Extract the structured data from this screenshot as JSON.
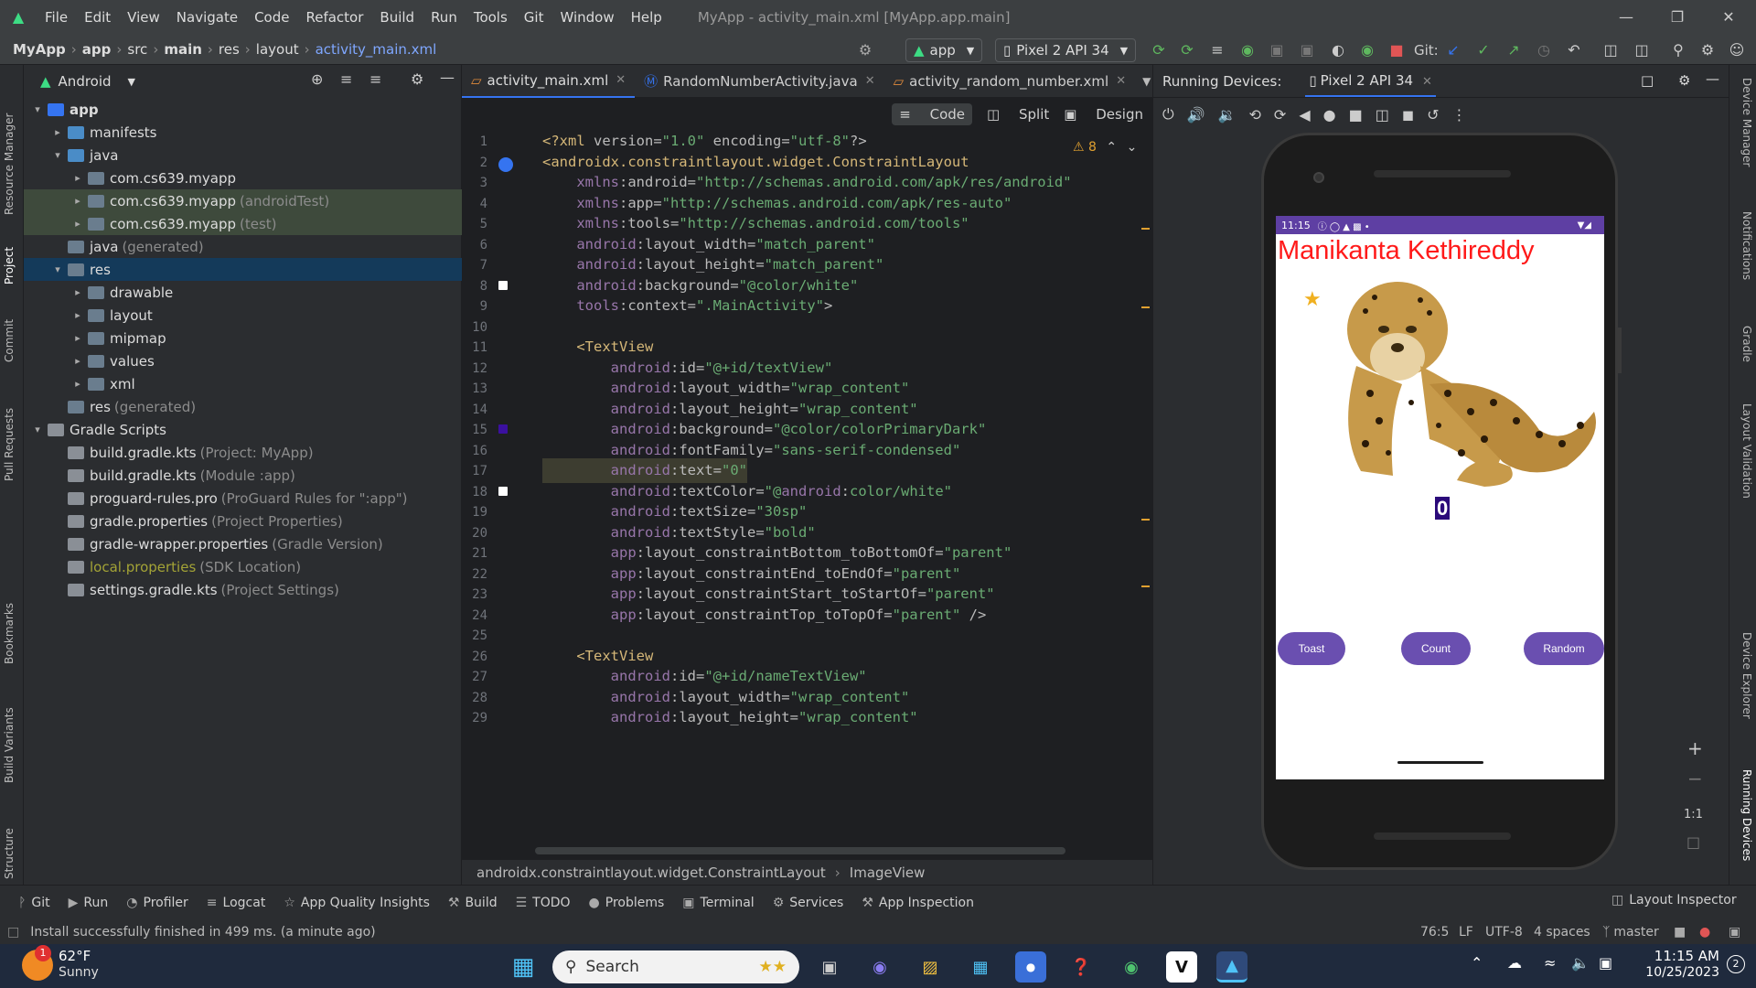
{
  "menu": {
    "items": [
      "File",
      "Edit",
      "View",
      "Navigate",
      "Code",
      "Refactor",
      "Build",
      "Run",
      "Tools",
      "Git",
      "Window",
      "Help"
    ],
    "title": "MyApp - activity_main.xml [MyApp.app.main]"
  },
  "nav": {
    "crumbs": [
      "MyApp",
      "app",
      "src",
      "main",
      "res",
      "layout",
      "activity_main.xml"
    ],
    "run_config": "app",
    "device": "Pixel 2 API 34",
    "git_label": "Git:"
  },
  "project": {
    "view_label": "Android",
    "tree": [
      {
        "label": "app",
        "sub": "",
        "bold": true
      },
      {
        "label": "manifests",
        "sub": ""
      },
      {
        "label": "java",
        "sub": ""
      },
      {
        "label": "com.cs639.myapp",
        "sub": ""
      },
      {
        "label": "com.cs639.myapp",
        "sub": "(androidTest)"
      },
      {
        "label": "com.cs639.myapp",
        "sub": "(test)"
      },
      {
        "label": "java",
        "sub": "(generated)"
      },
      {
        "label": "res",
        "sub": ""
      },
      {
        "label": "drawable",
        "sub": ""
      },
      {
        "label": "layout",
        "sub": ""
      },
      {
        "label": "mipmap",
        "sub": ""
      },
      {
        "label": "values",
        "sub": ""
      },
      {
        "label": "xml",
        "sub": ""
      },
      {
        "label": "res",
        "sub": "(generated)"
      },
      {
        "label": "Gradle Scripts",
        "sub": ""
      },
      {
        "label": "build.gradle.kts",
        "sub": "(Project: MyApp)"
      },
      {
        "label": "build.gradle.kts",
        "sub": "(Module :app)"
      },
      {
        "label": "proguard-rules.pro",
        "sub": "(ProGuard Rules for \":app\")"
      },
      {
        "label": "gradle.properties",
        "sub": "(Project Properties)"
      },
      {
        "label": "gradle-wrapper.properties",
        "sub": "(Gradle Version)"
      },
      {
        "label": "local.properties",
        "sub": "(SDK Location)"
      },
      {
        "label": "settings.gradle.kts",
        "sub": "(Project Settings)"
      }
    ]
  },
  "left_strip": [
    "Resource Manager",
    "Project",
    "Commit",
    "Pull Requests",
    "Bookmarks",
    "Build Variants",
    "Structure"
  ],
  "right_strip": [
    "Device Manager",
    "Notifications",
    "Gradle",
    "Layout Validation",
    "Device Explorer",
    "Running Devices"
  ],
  "editor": {
    "tabs": [
      "activity_main.xml",
      "RandomNumberActivity.java",
      "activity_random_number.xml"
    ],
    "view_modes": [
      "Code",
      "Split",
      "Design"
    ],
    "warnings": "8",
    "lines": [
      "<?xml version=\"1.0\" encoding=\"utf-8\"?>",
      "<androidx.constraintlayout.widget.ConstraintLayout",
      "    xmlns:android=\"http://schemas.android.com/apk/res/android\"",
      "    xmlns:app=\"http://schemas.android.com/apk/res-auto\"",
      "    xmlns:tools=\"http://schemas.android.com/tools\"",
      "    android:layout_width=\"match_parent\"",
      "    android:layout_height=\"match_parent\"",
      "    android:background=\"@color/white\"",
      "    tools:context=\".MainActivity\">",
      "",
      "    <TextView",
      "        android:id=\"@+id/textView\"",
      "        android:layout_width=\"wrap_content\"",
      "        android:layout_height=\"wrap_content\"",
      "        android:background=\"@color/colorPrimaryDark\"",
      "        android:fontFamily=\"sans-serif-condensed\"",
      "        android:text=\"0\"",
      "        android:textColor=\"@android:color/white\"",
      "        android:textSize=\"30sp\"",
      "        android:textStyle=\"bold\"",
      "        app:layout_constraintBottom_toBottomOf=\"parent\"",
      "        app:layout_constraintEnd_toEndOf=\"parent\"",
      "        app:layout_constraintStart_toStartOf=\"parent\"",
      "        app:layout_constraintTop_toTopOf=\"parent\" />",
      "",
      "    <TextView",
      "        android:id=\"@+id/nameTextView\"",
      "        android:layout_width=\"wrap_content\"",
      "        android:layout_height=\"wrap_content\""
    ],
    "breadcrumb": [
      "androidx.constraintlayout.widget.ConstraintLayout",
      "ImageView"
    ]
  },
  "devices": {
    "label": "Running Devices:",
    "tab": "Pixel 2 API 34",
    "phone": {
      "time": "11:15",
      "name": "Manikanta Kethireddy",
      "counter": "0",
      "buttons": [
        "Toast",
        "Count",
        "Random"
      ]
    },
    "zoom": [
      "+",
      "−",
      "1:1"
    ]
  },
  "toolwindows": [
    "Git",
    "Run",
    "Profiler",
    "Logcat",
    "App Quality Insights",
    "Build",
    "TODO",
    "Problems",
    "Terminal",
    "Services",
    "App Inspection"
  ],
  "layout_inspector": "Layout Inspector",
  "status": {
    "message": "Install successfully finished in 499 ms. (a minute ago)",
    "position": "76:5",
    "line_sep": "LF",
    "encoding": "UTF-8",
    "indent": "4 spaces",
    "branch": "master"
  },
  "taskbar": {
    "weather_temp": "62°F",
    "weather_desc": "Sunny",
    "weather_badge": "1",
    "search": "Search",
    "time": "11:15 AM",
    "date": "10/25/2023",
    "notif": "2"
  },
  "colors": {
    "accent": "#3574f0",
    "android": "#3ddc84",
    "phone_bar": "#5e3fa3",
    "button": "#6a4fb0",
    "name": "#ff1a1a"
  }
}
